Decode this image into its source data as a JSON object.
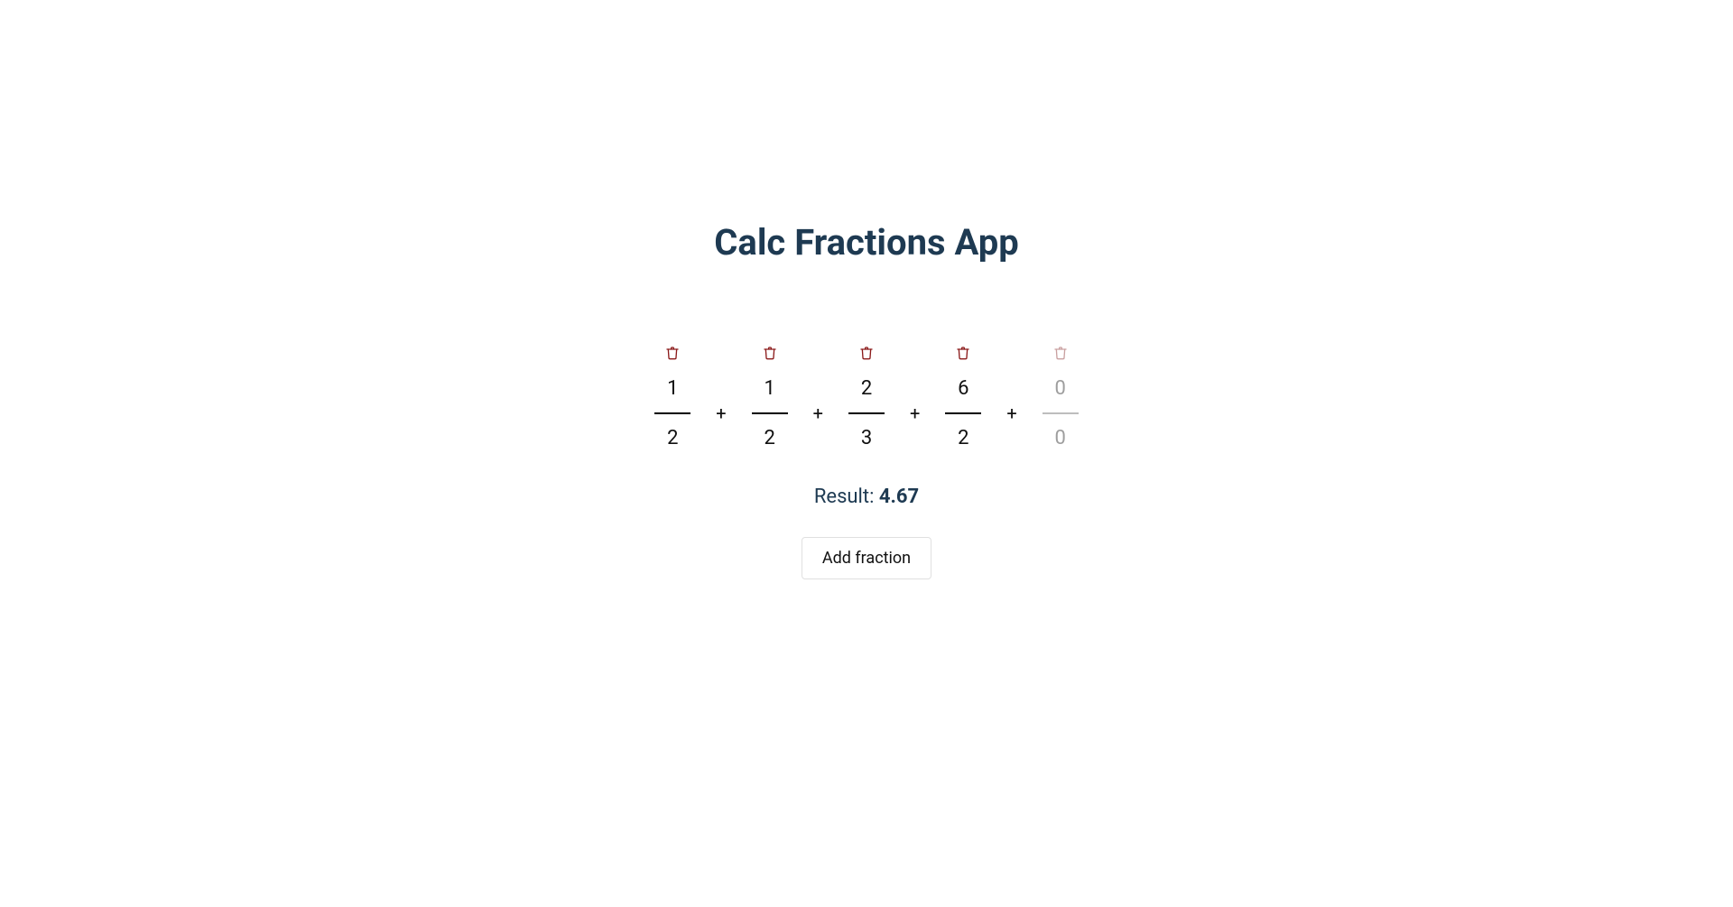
{
  "title": "Calc Fractions App",
  "operator": "+",
  "placeholder": "0",
  "fractions": [
    {
      "numerator": "1",
      "denominator": "2",
      "empty": false
    },
    {
      "numerator": "1",
      "denominator": "2",
      "empty": false
    },
    {
      "numerator": "2",
      "denominator": "3",
      "empty": false
    },
    {
      "numerator": "6",
      "denominator": "2",
      "empty": false
    },
    {
      "numerator": "",
      "denominator": "",
      "empty": true
    }
  ],
  "result_label": "Result: ",
  "result_value": "4.67",
  "add_button_label": "Add fraction",
  "colors": {
    "heading": "#1e3a52",
    "trash": "#8b1a1a",
    "trash_faded": "#c9a0a0"
  }
}
